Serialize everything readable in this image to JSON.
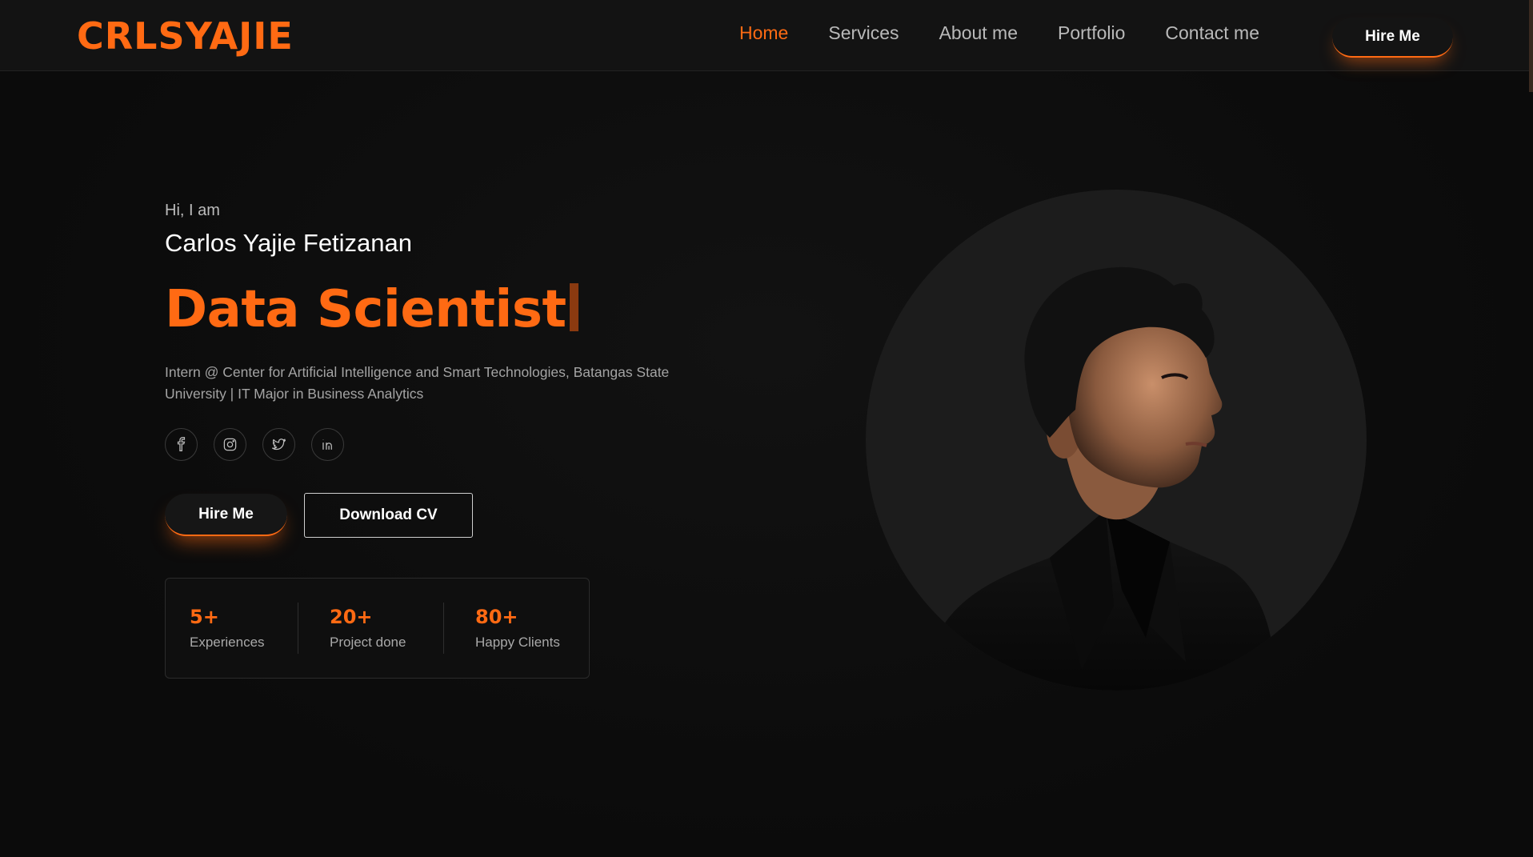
{
  "nav": {
    "logo": "CRLSYAJIE",
    "links": [
      "Home",
      "Services",
      "About me",
      "Portfolio",
      "Contact me"
    ],
    "hire_label": "Hire Me"
  },
  "hero": {
    "greeting": "Hi, I am",
    "name": "Carlos Yajie Fetizanan",
    "role": "Data Scientist",
    "description": "Intern @ Center for Artificial Intelligence and Smart Technologies, Batangas State University | IT Major in Business Analytics",
    "socials": [
      "facebook-icon",
      "instagram-icon",
      "twitter-icon",
      "linkedin-icon"
    ],
    "hire_label": "Hire Me",
    "cv_label": "Download CV"
  },
  "stats": [
    {
      "value": "5+",
      "label": "Experiences"
    },
    {
      "value": "20+",
      "label": "Project done"
    },
    {
      "value": "80+",
      "label": "Happy Clients"
    }
  ],
  "colors": {
    "accent": "#ff6a13",
    "background": "#0d0d0d",
    "nav_background": "#131313"
  }
}
